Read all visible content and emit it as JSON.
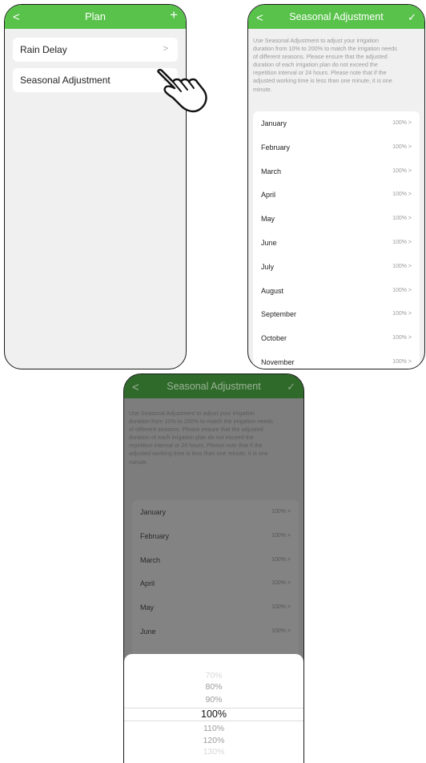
{
  "phone1": {
    "header": {
      "back": "<",
      "title": "Plan",
      "action": "+"
    },
    "items": [
      {
        "label": "Rain Delay",
        "chevron": ">"
      },
      {
        "label": "Seasonal Adjustment",
        "chevron": ">"
      }
    ]
  },
  "phone2": {
    "header": {
      "back": "<",
      "title": "Seasonal Adjustment",
      "action": "✓"
    },
    "description": [
      "Use Seasonal Adjustment to adjust your irrigation",
      "duration from 10% to 200% to match the irrigation needs",
      "of different seasons. Please ensure that the adjusted",
      "duration of each irrigation plan do not exceed the",
      "repetition interval or 24 hours. Please note that if the",
      "adjusted working time is less than one minute, it is one",
      "minute."
    ],
    "months": [
      {
        "name": "January",
        "value": "100% >"
      },
      {
        "name": "February",
        "value": "100% >"
      },
      {
        "name": "March",
        "value": "100% >"
      },
      {
        "name": "April",
        "value": "100% >"
      },
      {
        "name": "May",
        "value": "100% >"
      },
      {
        "name": "June",
        "value": "100% >"
      },
      {
        "name": "July",
        "value": "100% >"
      },
      {
        "name": "August",
        "value": "100% >"
      },
      {
        "name": "September",
        "value": "100% >"
      },
      {
        "name": "October",
        "value": "100% >"
      },
      {
        "name": "November",
        "value": "100% >"
      }
    ]
  },
  "phone3": {
    "header": {
      "back": "<",
      "title": "Seasonal Adjustment",
      "action": "✓"
    },
    "description": [
      "Use Seasonal Adjustment to adjust your irrigation",
      "duration from 10% to 200% to match the irrigation needs",
      "of different seasons. Please ensure that the adjusted",
      "duration of each irrigation plan do not exceed the",
      "repetition interval or 24 hours. Please note that if the",
      "adjusted working time is less than one minute, it is one",
      "minute."
    ],
    "months": [
      {
        "name": "January",
        "value": "100% >"
      },
      {
        "name": "February",
        "value": "100% >"
      },
      {
        "name": "March",
        "value": "100% >"
      },
      {
        "name": "April",
        "value": "100% >"
      },
      {
        "name": "May",
        "value": "100% >"
      },
      {
        "name": "June",
        "value": "100% >"
      }
    ],
    "picker": {
      "options": [
        "70%",
        "80%",
        "90%",
        "100%",
        "110%",
        "120%",
        "130%"
      ],
      "selected": "100%"
    }
  },
  "icons": [
    "hand-pointer-icon",
    "chevron-right-icon",
    "back-arrow-icon",
    "plus-icon",
    "check-icon"
  ],
  "colors": {
    "header_green": "#58c24a",
    "header_dim": "#2f6a2a",
    "background": "#f0f0f0",
    "overlay": "#7d7d7d"
  }
}
